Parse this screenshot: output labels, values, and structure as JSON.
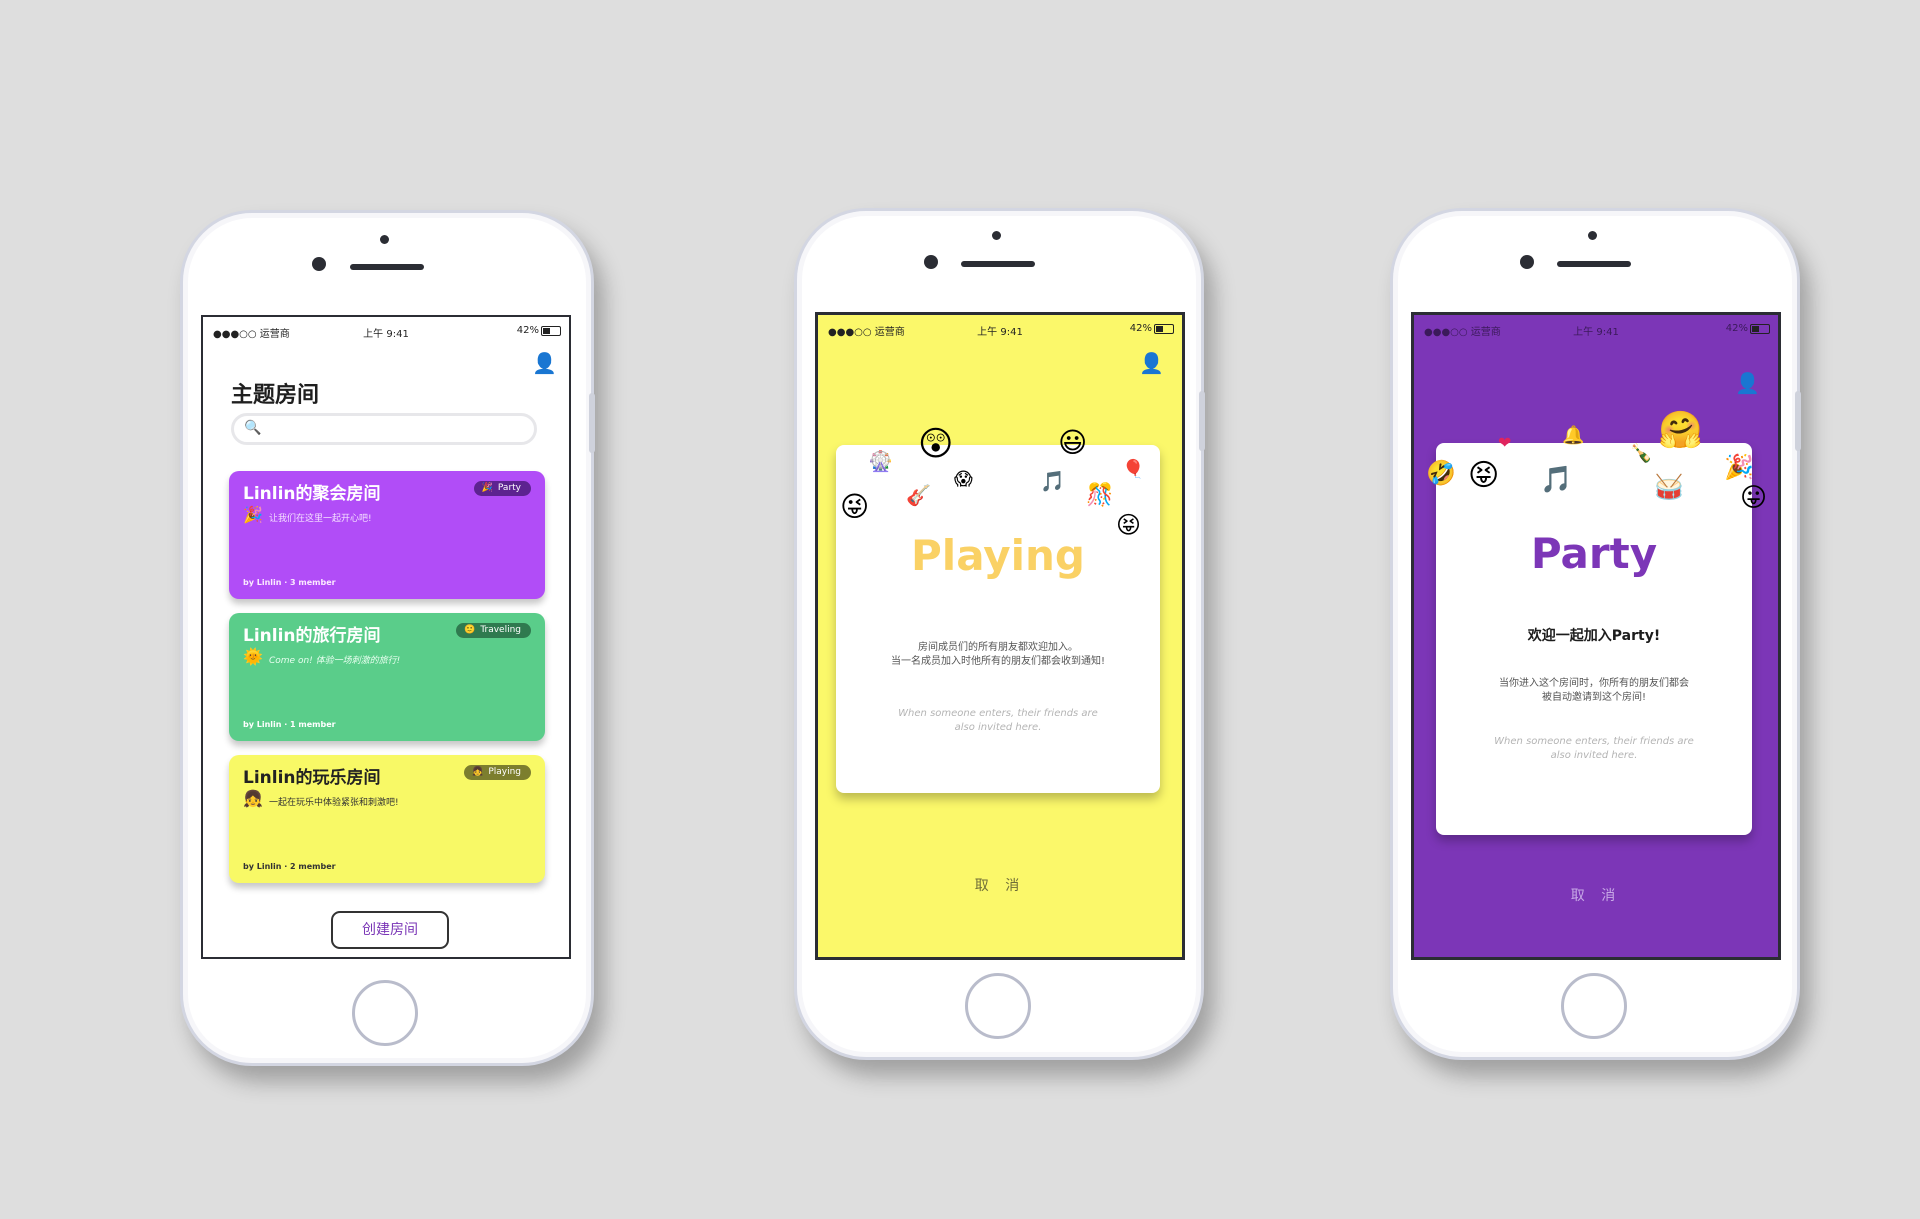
{
  "status_bar": {
    "carrier": "●●●○○ 运营商",
    "time": "上午 9:41",
    "battery": "42%"
  },
  "icons": {
    "profile": "profile-list-icon",
    "search": "search-icon",
    "wifi": "wifi-icon",
    "bluetooth": "bluetooth-icon",
    "battery": "battery-icon"
  },
  "colors": {
    "background": "#dedede",
    "purple": "#b14df7",
    "green": "#5acd8a",
    "yellow": "#f8f966",
    "dialog_yellow": "#fbf86a",
    "dialog_purple": "#7c36b7",
    "playing_title": "#fad165",
    "party_title": "#7c36b7"
  },
  "home_screen": {
    "title": "主题房间",
    "search": {
      "placeholder": ""
    },
    "rooms": [
      {
        "name": "Linlin的聚会房间",
        "tag": "Party",
        "tag_icon": "party-popper-icon",
        "emoji": "🎉",
        "desc": "让我们在这里一起开心吧!",
        "by": "by  Linlin · 3 member"
      },
      {
        "name": "Linlin的旅行房间",
        "tag": "Traveling",
        "tag_icon": "smile-icon",
        "emoji": "🌞",
        "desc": "Come on! 体验一场刺激的旅行!",
        "by": "by  Linlin · 1 member"
      },
      {
        "name": "Linlin的玩乐房间",
        "tag": "Playing",
        "tag_icon": "girl-icon",
        "emoji": "👧",
        "desc": "一起在玩乐中体验紧张和刺激吧!",
        "by": "by  Linlin · 2 member"
      }
    ],
    "create_button": "创建房间"
  },
  "playing_screen": {
    "title": "Playing",
    "text_line1": "房间成员们的所有朋友都欢迎加入。",
    "text_line2": "当一名成员加入时他所有的朋友们都会收到通知!",
    "note_line1": "When someone enters, their friends are",
    "note_line2": "also invited here.",
    "cancel": "取 消",
    "emojis": [
      "😲",
      "😃",
      "🎡",
      "😱",
      "🎵",
      "🎈",
      "😜",
      "🎸",
      "🎊",
      "😝"
    ]
  },
  "party_screen": {
    "title": "Party",
    "subtitle": "欢迎一起加入Party!",
    "text_line1": "当你进入这个房间时，你所有的朋友们都会",
    "text_line2": "被自动邀请到这个房间!",
    "note_line1": "When someone enters, their friends are",
    "note_line2": "also invited here.",
    "cancel": "取 消",
    "emojis": [
      "🤗",
      "❤",
      "🔔",
      "🍾",
      "🤣",
      "😝",
      "🎵",
      "🥁",
      "🎉",
      "😛"
    ]
  }
}
